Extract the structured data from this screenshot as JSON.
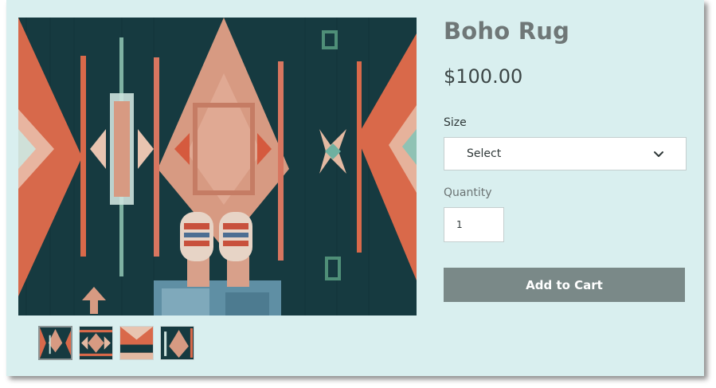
{
  "product": {
    "title": "Boho Rug",
    "price": "$100.00"
  },
  "size": {
    "label": "Size",
    "selected": "Select"
  },
  "quantity": {
    "label": "Quantity",
    "value": "1"
  },
  "actions": {
    "add_to_cart_label": "Add to Cart"
  },
  "gallery": {
    "thumbnail_count": 4,
    "selected_index": 0
  },
  "colors": {
    "background": "#d9efef",
    "button": "#7a8988",
    "title": "#6f7777",
    "rug_teal": "#13343a",
    "rug_terracotta": "#d9694a",
    "rug_peach": "#d79a82"
  },
  "icons": {
    "select_chevron": "chevron-down-icon"
  }
}
